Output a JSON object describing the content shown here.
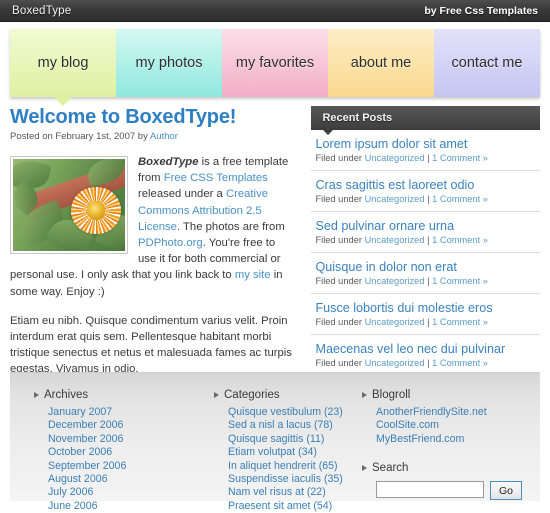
{
  "topbar": {
    "title": "BoxedType",
    "credit": "by Free Css Templates"
  },
  "nav": {
    "items": [
      {
        "label": "my blog",
        "color": "#dff0a0",
        "color_top": "#f3fad2",
        "active": true
      },
      {
        "label": "my photos",
        "color": "#8ee8dd",
        "color_top": "#d5f8f3",
        "active": false
      },
      {
        "label": "my favorites",
        "color": "#f3aec6",
        "color_top": "#fbdfe9",
        "active": false
      },
      {
        "label": "about me",
        "color": "#fbd88e",
        "color_top": "#fdeec6",
        "active": false
      },
      {
        "label": "contact me",
        "color": "#c5c5f2",
        "color_top": "#e2e2fa",
        "active": false
      }
    ]
  },
  "post": {
    "title": "Welcome to BoxedType!",
    "meta_prefix": "Posted on February 1st, 2007 by ",
    "meta_author": "Author",
    "paragraph1": {
      "t1": "BoxedType",
      "t2": " is a free template from ",
      "link1": "Free CSS Templates",
      "t3": " released under a ",
      "link2": "Creative Commons Attribution 2.5 License",
      "t4": ". The photos are from ",
      "link3": "PDPhoto.org",
      "t5": ". You're free to use it for both commercial or personal use. I only ask that you link back to ",
      "link4": "my site",
      "t6": " in some way. Enjoy :)"
    },
    "paragraph2": "Etiam eu nibh. Quisque condimentum varius velit. Proin interdum erat quis sem. Pellentesque habitant morbi tristique senectus et netus et malesuada fames ac turpis egestas. Vivamus in odio.",
    "image_alt": "orange gazania flower in green foliage"
  },
  "sidebar": {
    "heading": "Recent Posts",
    "posts": [
      {
        "title": "Lorem ipsum dolor sit amet",
        "filed_label": "Filed under ",
        "category": "Uncategorized",
        "sep": " | ",
        "comments": "1 Comment »"
      },
      {
        "title": "Cras sagittis est laoreet odio",
        "filed_label": "Filed under ",
        "category": "Uncategorized",
        "sep": " | ",
        "comments": "1 Comment »"
      },
      {
        "title": "Sed pulvinar ornare urna",
        "filed_label": "Filed under ",
        "category": "Uncategorized",
        "sep": " | ",
        "comments": "1 Comment »"
      },
      {
        "title": "Quisque in dolor non erat",
        "filed_label": "Filed under ",
        "category": "Uncategorized",
        "sep": " | ",
        "comments": "1 Comment »"
      },
      {
        "title": "Fusce lobortis dui molestie eros",
        "filed_label": "Filed under ",
        "category": "Uncategorized",
        "sep": " | ",
        "comments": "1 Comment »"
      },
      {
        "title": "Maecenas vel leo nec dui pulvinar",
        "filed_label": "Filed under ",
        "category": "Uncategorized",
        "sep": " | ",
        "comments": "1 Comment »"
      }
    ]
  },
  "footer": {
    "archives": {
      "heading": "Archives",
      "items": [
        "January 2007",
        "December 2006",
        "November 2006",
        "October 2006",
        "September 2006",
        "August 2006",
        "July 2006",
        "June 2006"
      ]
    },
    "categories": {
      "heading": "Categories",
      "items": [
        "Quisque vestibulum (23)",
        "Sed a nisl a lacus (78)",
        "Quisque sagittis (11)",
        "Etiam volutpat (34)",
        "In aliquet hendrerit (65)",
        "Suspendisse iaculis (35)",
        "Nam vel risus at (22)",
        "Praesent sit amet (54)"
      ]
    },
    "blogroll": {
      "heading": "Blogroll",
      "items": [
        "AnotherFriendlySite.net",
        "CoolSite.com",
        "MyBestFriend.com"
      ]
    },
    "search": {
      "heading": "Search",
      "value": "",
      "placeholder": "",
      "button_label": "Go"
    }
  }
}
